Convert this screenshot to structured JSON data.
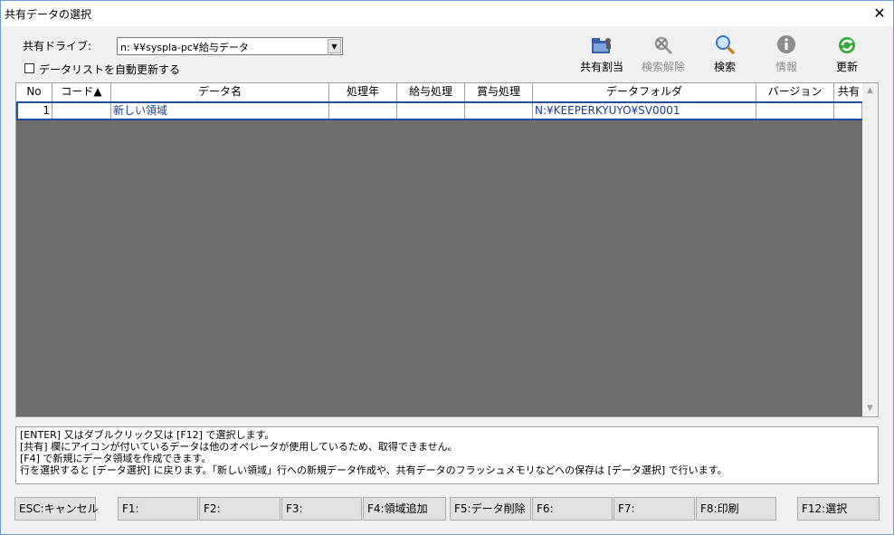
{
  "window": {
    "title": "共有データの選択"
  },
  "drive": {
    "label": "共有ドライブ:",
    "value": "n: ¥¥syspla-pc¥給与データ"
  },
  "auto_refresh": {
    "label": "データリストを自動更新する",
    "checked": false
  },
  "toolbar": {
    "share_assign": "共有割当",
    "search_clear": "検索解除",
    "search": "検索",
    "info": "情報",
    "refresh": "更新"
  },
  "grid": {
    "headers": {
      "no": "No",
      "code": "コード▲",
      "name": "データ名",
      "year": "処理年",
      "salary": "給与処理",
      "bonus": "賞与処理",
      "folder": "データフォルダ",
      "version": "バージョン",
      "shared": "共有"
    },
    "rows": [
      {
        "no": "1",
        "code": "",
        "name": "新しい領域",
        "year": "",
        "salary": "",
        "bonus": "",
        "folder": "N:¥KEEPERKYUYO¥SV0001",
        "version": "",
        "shared": ""
      }
    ]
  },
  "info_lines": [
    "[ENTER] 又はダブルクリック又は [F12] で選択します。",
    "[共有] 欄にアイコンが付いているデータは他のオペレータが使用しているため、取得できません。",
    "[F4] で新規にデータ領域を作成できます。",
    "行を選択すると [データ選択] に戻ります。「新しい領域」行への新規データ作成や、共有データのフラッシュメモリなどへの保存は [データ選択] で行います。"
  ],
  "fkeys": {
    "esc": "ESC:キャンセル",
    "f1": "F1:",
    "f2": "F2:",
    "f3": "F3:",
    "f4": "F4:領域追加",
    "f5": "F5:データ削除",
    "f6": "F6:",
    "f7": "F7:",
    "f8": "F8:印刷",
    "f12": "F12:選択"
  },
  "icons": {
    "close": "close-icon",
    "share_assign": "folder-share-icon",
    "search_clear": "search-clear-icon",
    "search": "magnifier-icon",
    "info": "info-icon",
    "refresh": "refresh-icon"
  },
  "colors": {
    "grid_bg": "#6d6d6d",
    "selection_border": "#1f4e9b",
    "window_border": "#6f9dd5"
  }
}
